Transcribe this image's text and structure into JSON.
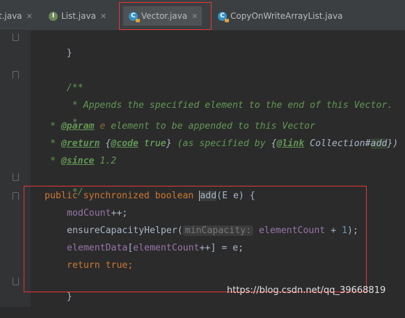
{
  "tabs": [
    {
      "label": "t.java",
      "icon": "class-file-icon",
      "active": false
    },
    {
      "label": "List.java",
      "icon": "interface-file-icon",
      "active": false
    },
    {
      "label": "Vector.java",
      "icon": "class-file-icon",
      "active": true
    },
    {
      "label": "CopyOnWriteArrayList.java",
      "icon": "class-file-icon",
      "active": false
    }
  ],
  "code": {
    "l1_brace": "}",
    "doc_open": "/**",
    "doc_line1": " * Appends the specified element to the end of this Vector.",
    "doc_star": " *",
    "doc_param_star": " * ",
    "doc_param_tag": "@param",
    "doc_param_name": " e",
    "doc_param_text": " element to be appended to this Vector",
    "doc_return_star": " * ",
    "doc_return_tag": "@return",
    "doc_return_open": " {",
    "doc_code_tag": "@code",
    "doc_code_val": " true",
    "doc_return_close": "}",
    "doc_return_text": " (as specified by ",
    "doc_link_open": "{",
    "doc_link_tag": "@link",
    "doc_link_class": " Collection#",
    "doc_link_method": "add",
    "doc_link_close": "})",
    "doc_since_star": " * ",
    "doc_since_tag": "@since",
    "doc_since_val": " 1.2",
    "doc_close": " */",
    "sig_public": "public",
    "sig_sync": " synchronized",
    "sig_boolean": " boolean ",
    "sig_name": "add",
    "sig_params": "(E e) {",
    "b1_field": "modCount",
    "b1_rest": "++;",
    "b2_call": "ensureCapacityHelper(",
    "b2_hint": "minCapacity:",
    "b2_arg": " elementCount",
    "b2_plus": " + ",
    "b2_num": "1",
    "b2_end": ");",
    "b3_field": "elementData",
    "b3_open": "[",
    "b3_idx": "elementCount",
    "b3_rest": "++] = e;",
    "b4_return": "return",
    "b4_true": " true",
    "b4_end": ";",
    "end_brace": "}"
  },
  "watermark": "https://blog.csdn.net/qq_39668819",
  "colors": {
    "keyword": "#cc7832",
    "field": "#9876aa",
    "javadoc": "#629755",
    "number": "#6897bb",
    "highlight_box": "#e53935"
  }
}
